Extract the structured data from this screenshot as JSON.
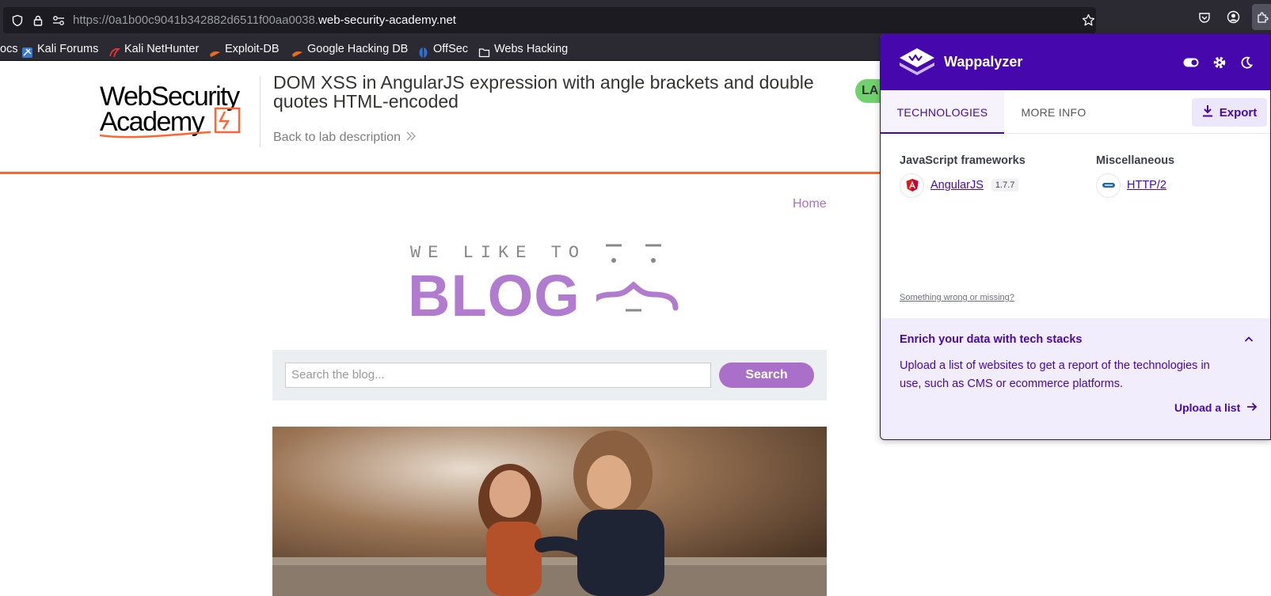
{
  "browser": {
    "url_host_prefix": "https://0a1b00c9041b342882d6511f00aa0038.",
    "url_domain": "web-security-academy.net",
    "bookmarks": [
      {
        "label": "ocs",
        "icon": "docs-icon"
      },
      {
        "label": "Kali Forums",
        "icon": "kali-forums-icon"
      },
      {
        "label": "Kali NetHunter",
        "icon": "kali-nethunter-icon"
      },
      {
        "label": "Exploit-DB",
        "icon": "exploit-db-icon"
      },
      {
        "label": "Google Hacking DB",
        "icon": "google-hacking-db-icon"
      },
      {
        "label": "OffSec",
        "icon": "offsec-icon"
      },
      {
        "label": "Webs Hacking",
        "icon": "folder-icon"
      }
    ]
  },
  "lab": {
    "logo_line1": "WebSecurity",
    "logo_line2": "Academy",
    "title": "DOM XSS in AngularJS expression with angle brackets and double quotes HTML-encoded",
    "back_link": "Back to lab description",
    "status_badge": "LA"
  },
  "blog": {
    "home_link": "Home",
    "tagline": "WE LIKE TO",
    "word": "BLOG",
    "search_placeholder": "Search the blog...",
    "search_button": "Search"
  },
  "wappalyzer": {
    "brand": "Wappalyzer",
    "tabs": [
      "TECHNOLOGIES",
      "MORE INFO"
    ],
    "export_label": "Export",
    "categories": [
      {
        "title": "JavaScript frameworks",
        "tech": "AngularJS",
        "version": "1.7.7",
        "icon": "angularjs-icon"
      },
      {
        "title": "Miscellaneous",
        "tech": "HTTP/2",
        "version": "",
        "icon": "http2-icon"
      }
    ],
    "wrong_link": "Something wrong or missing?",
    "enrich_title": "Enrich your data with tech stacks",
    "enrich_text": "Upload a list of websites to get a report of the technologies in use, such as CMS or ecommerce platforms.",
    "upload_link": "Upload a list"
  },
  "colors": {
    "chrome_bg": "#2b2a33",
    "academy_orange": "#ff6633",
    "blog_purple": "#a96fc9",
    "wappalyzer_purple": "#4608ad",
    "lab_badge_green": "#70d16d"
  }
}
